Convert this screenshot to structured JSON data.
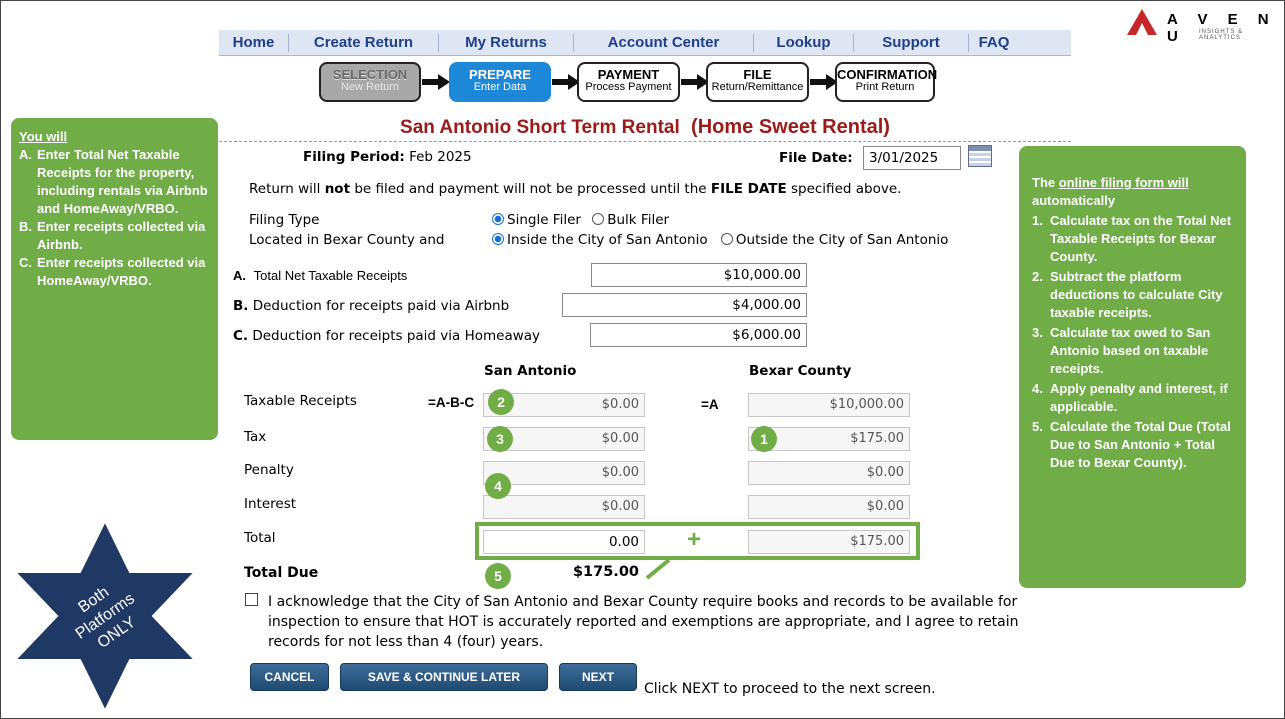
{
  "nav": [
    "Home",
    "Create Return",
    "My Returns",
    "Account Center",
    "Lookup",
    "Support",
    "FAQ"
  ],
  "logo": {
    "name": "A V E N U",
    "sub": "INSIGHTS & ANALYTICS",
    "color": "#c62828"
  },
  "steps": [
    {
      "title": "SELECTION",
      "sub": "New Return"
    },
    {
      "title": "PREPARE",
      "sub": "Enter Data"
    },
    {
      "title": "PAYMENT",
      "sub": "Process Payment"
    },
    {
      "title": "FILE",
      "sub": "Return/Remittance"
    },
    {
      "title": "CONFIRMATION",
      "sub": "Print Return"
    }
  ],
  "page_title": "San Antonio Short Term Rental",
  "page_title_suffix": "(Home Sweet Rental)",
  "filing_period_label": "Filing Period:",
  "filing_period_value": "Feb 2025",
  "file_date_label": "File Date:",
  "file_date_value": "3/01/2025",
  "notice_pre": "Return will ",
  "notice_bold1": "not",
  "notice_mid": " be filed and payment will not be processed until the ",
  "notice_bold2": "FILE DATE",
  "notice_post": " specified above.",
  "filing_type_label": "Filing Type",
  "filing_type_options": [
    "Single Filer",
    "Bulk Filer"
  ],
  "location_label": "Located in Bexar County and",
  "location_options": [
    "Inside the City of San Antonio",
    "Outside the City of San Antonio"
  ],
  "line_a_letter": "A.",
  "line_a_label": "Total Net Taxable Receipts",
  "line_a_value": "$10,000.00",
  "line_b_letter": "B.",
  "line_b_label": "Deduction for receipts paid via Airbnb",
  "line_b_value": "$4,000.00",
  "line_c_letter": "C.",
  "line_c_label": "Deduction  for receipts paid via Homeaway",
  "line_c_value": "$6,000.00",
  "col_sa": "San Antonio",
  "col_bc": "Bexar County",
  "formula_sa": "=A-B-C",
  "formula_bc": "=A",
  "rows": {
    "taxable": {
      "label": "Taxable Receipts",
      "sa": "$0.00",
      "bc": "$10,000.00"
    },
    "tax": {
      "label": "Tax",
      "sa": "$0.00",
      "bc": "$175.00"
    },
    "penalty": {
      "label": "Penalty",
      "sa": "$0.00",
      "bc": "$0.00"
    },
    "interest": {
      "label": "Interest",
      "sa": "$0.00",
      "bc": "$0.00"
    },
    "total": {
      "label": "Total",
      "sa": "0.00",
      "bc": "$175.00"
    }
  },
  "plus": "+",
  "total_due_label": "Total Due",
  "total_due_value": "$175.00",
  "markers": [
    "1",
    "2",
    "3",
    "4",
    "5"
  ],
  "ack_text": "I acknowledge that the City of San Antonio and Bexar County require books and records to be available for inspection to ensure that HOT is accurately reported and exemptions are appropriate, and I agree to retain records for not less than 4 (four) years.",
  "buttons": {
    "cancel": "CANCEL",
    "save": "SAVE & CONTINUE LATER",
    "next": "NEXT"
  },
  "next_hint": "Click NEXT to proceed to the next screen.",
  "left_panel": {
    "heading": "You will",
    "items": [
      {
        "k": "A.",
        "t": "Enter Total Net Taxable Receipts for the property, including rentals via Airbnb and HomeAway/VRBO."
      },
      {
        "k": "B.",
        "t": "Enter receipts collected via Airbnb."
      },
      {
        "k": "C.",
        "t": "Enter receipts collected via HomeAway/VRBO."
      }
    ]
  },
  "right_panel": {
    "pre": "The ",
    "link": "online filing form will",
    "post": "automatically",
    "items": [
      {
        "k": "1.",
        "t": "Calculate tax on the Total Net Taxable Receipts for Bexar County."
      },
      {
        "k": "2.",
        "t": "Subtract the platform deductions to calculate City taxable receipts."
      },
      {
        "k": "3.",
        "t": "Calculate tax owed to San Antonio based on taxable receipts."
      },
      {
        "k": "4.",
        "t": "Apply penalty and interest, if applicable."
      },
      {
        "k": "5.",
        "t": "Calculate the Total Due (Total Due to San Antonio + Total Due to Bexar County)."
      }
    ]
  },
  "star_text": [
    "Both",
    "Platforms",
    "ONLY"
  ],
  "colors": {
    "green": "#70ad47",
    "star": "#1f3864",
    "title": "#9b1b1b",
    "prepare": "#1e88d8"
  }
}
